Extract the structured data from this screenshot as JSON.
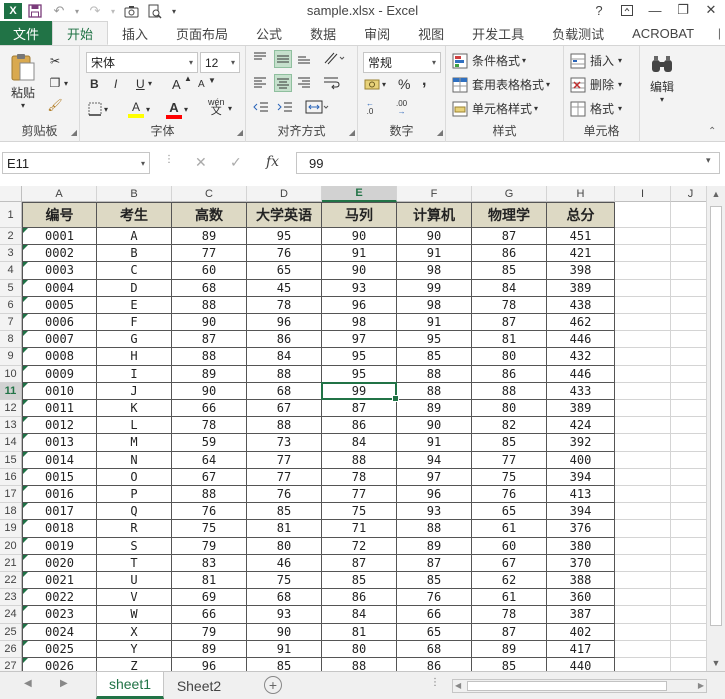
{
  "window": {
    "title": "sample.xlsx - Excel",
    "help": "?",
    "minimize": "—",
    "restore": "❐",
    "close": "✕"
  },
  "qat": {
    "logo": "X",
    "save": "💾",
    "undo": "↶",
    "redo": "↷",
    "more": "▾"
  },
  "ribbon_tabs": [
    "文件",
    "开始",
    "插入",
    "页面布局",
    "公式",
    "数据",
    "审阅",
    "视图",
    "开发工具",
    "负载测试",
    "ACROBAT"
  ],
  "active_tab": "开始",
  "ribbon": {
    "clipboard": {
      "label": "剪贴板",
      "paste": "粘贴"
    },
    "font": {
      "label": "字体",
      "name": "宋体",
      "size": "12",
      "bold": "B",
      "italic": "I",
      "underline": "U",
      "grow": "A",
      "shrink": "A",
      "fill": "A",
      "color": "A",
      "wen": "wén"
    },
    "alignment": {
      "label": "对齐方式"
    },
    "number": {
      "label": "数字",
      "format": "常规",
      "percent": "%",
      "comma": ",",
      "inc": ".0",
      "dec": ".00"
    },
    "styles": {
      "label": "样式",
      "conditional": "条件格式",
      "table": "套用表格格式",
      "cell": "单元格样式"
    },
    "cells": {
      "label": "单元格",
      "insert": "插入",
      "delete": "删除",
      "format": "格式"
    },
    "editing": {
      "label": "编辑"
    }
  },
  "formula_bar": {
    "name_box": "E11",
    "cancel": "✕",
    "enter": "✓",
    "fx": "fx",
    "value": "99"
  },
  "columns": [
    "A",
    "B",
    "C",
    "D",
    "E",
    "F",
    "G",
    "H",
    "I",
    "J"
  ],
  "rows": [
    "1",
    "2",
    "3",
    "4",
    "5",
    "6",
    "7",
    "8",
    "9",
    "10",
    "11",
    "12",
    "13",
    "14",
    "15",
    "16",
    "17",
    "18",
    "19",
    "20",
    "21",
    "22",
    "23",
    "24",
    "25",
    "26",
    "27"
  ],
  "active_cell": {
    "col": "E",
    "row": "11"
  },
  "table": {
    "headers": [
      "编号",
      "考生",
      "高数",
      "大学英语",
      "马列",
      "计算机",
      "物理学",
      "总分"
    ],
    "data": [
      [
        "0001",
        "A",
        "89",
        "95",
        "90",
        "90",
        "87",
        "451"
      ],
      [
        "0002",
        "B",
        "77",
        "76",
        "91",
        "91",
        "86",
        "421"
      ],
      [
        "0003",
        "C",
        "60",
        "65",
        "90",
        "98",
        "85",
        "398"
      ],
      [
        "0004",
        "D",
        "68",
        "45",
        "93",
        "99",
        "84",
        "389"
      ],
      [
        "0005",
        "E",
        "88",
        "78",
        "96",
        "98",
        "78",
        "438"
      ],
      [
        "0006",
        "F",
        "90",
        "96",
        "98",
        "91",
        "87",
        "462"
      ],
      [
        "0007",
        "G",
        "87",
        "86",
        "97",
        "95",
        "81",
        "446"
      ],
      [
        "0008",
        "H",
        "88",
        "84",
        "95",
        "85",
        "80",
        "432"
      ],
      [
        "0009",
        "I",
        "89",
        "88",
        "95",
        "88",
        "86",
        "446"
      ],
      [
        "0010",
        "J",
        "90",
        "68",
        "99",
        "88",
        "88",
        "433"
      ],
      [
        "0011",
        "K",
        "66",
        "67",
        "87",
        "89",
        "80",
        "389"
      ],
      [
        "0012",
        "L",
        "78",
        "88",
        "86",
        "90",
        "82",
        "424"
      ],
      [
        "0013",
        "M",
        "59",
        "73",
        "84",
        "91",
        "85",
        "392"
      ],
      [
        "0014",
        "N",
        "64",
        "77",
        "88",
        "94",
        "77",
        "400"
      ],
      [
        "0015",
        "O",
        "67",
        "77",
        "78",
        "97",
        "75",
        "394"
      ],
      [
        "0016",
        "P",
        "88",
        "76",
        "77",
        "96",
        "76",
        "413"
      ],
      [
        "0017",
        "Q",
        "76",
        "85",
        "75",
        "93",
        "65",
        "394"
      ],
      [
        "0018",
        "R",
        "75",
        "81",
        "71",
        "88",
        "61",
        "376"
      ],
      [
        "0019",
        "S",
        "79",
        "80",
        "72",
        "89",
        "60",
        "380"
      ],
      [
        "0020",
        "T",
        "83",
        "46",
        "87",
        "87",
        "67",
        "370"
      ],
      [
        "0021",
        "U",
        "81",
        "75",
        "85",
        "85",
        "62",
        "388"
      ],
      [
        "0022",
        "V",
        "69",
        "68",
        "86",
        "76",
        "61",
        "360"
      ],
      [
        "0023",
        "W",
        "66",
        "93",
        "84",
        "66",
        "78",
        "387"
      ],
      [
        "0024",
        "X",
        "79",
        "90",
        "81",
        "65",
        "87",
        "402"
      ],
      [
        "0025",
        "Y",
        "89",
        "91",
        "80",
        "68",
        "89",
        "417"
      ],
      [
        "0026",
        "Z",
        "96",
        "85",
        "88",
        "86",
        "85",
        "440"
      ]
    ]
  },
  "sheets": [
    "sheet1",
    "Sheet2"
  ],
  "active_sheet": "sheet1",
  "add_sheet": "+"
}
